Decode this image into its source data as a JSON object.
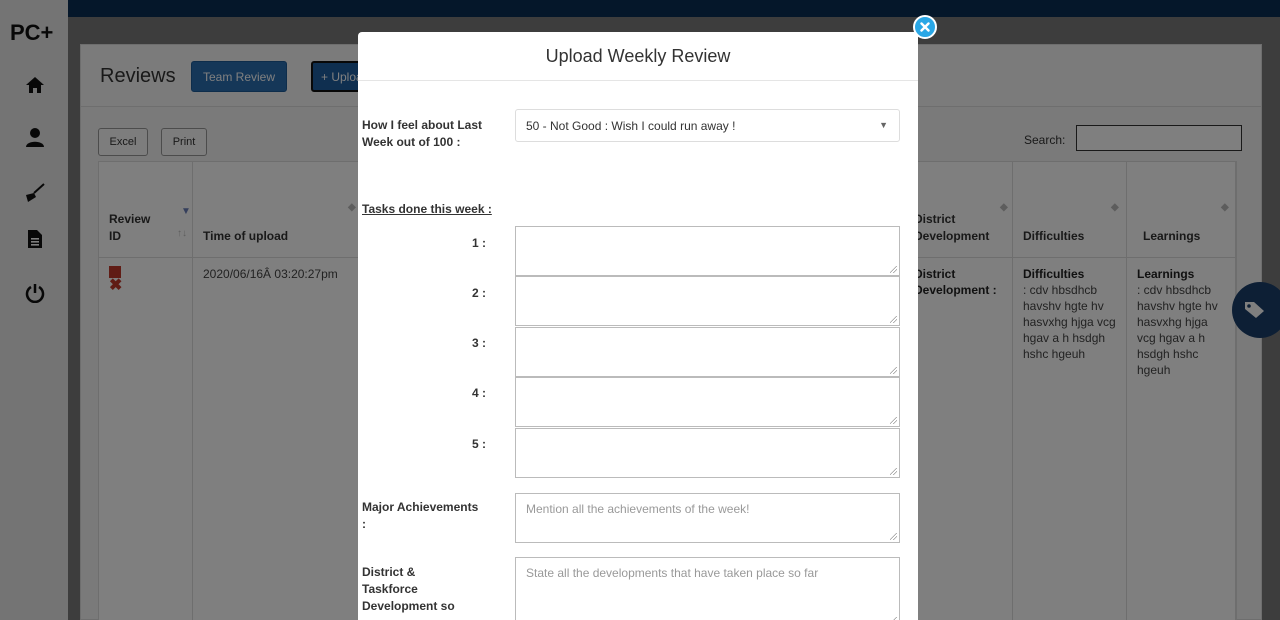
{
  "brand": "PC+",
  "sidebar": {
    "icons": [
      "home-icon",
      "user-icon",
      "broom-icon",
      "document-icon",
      "power-icon"
    ]
  },
  "page": {
    "title": "Reviews",
    "team_review_label": "Team Review",
    "upload_label": "+ Upload",
    "excel_label": "Excel",
    "print_label": "Print",
    "search_label": "Search:"
  },
  "table": {
    "headers": {
      "review_id": "Review ID",
      "time": "Time of upload",
      "district": "District Development",
      "difficulties": "Difficulties",
      "learnings": "Learnings"
    },
    "row": {
      "time": "2020/06/16Â 03:20:27pm",
      "district": "District Development :",
      "difficulties_title": "Difficulties",
      "difficulties_text": ": cdv hbsdhcb havshv hgte hv hasvxhg hjga vcg hgav a h hsdgh hshc hgeuh",
      "learnings_title": "Learnings",
      "learnings_text": ": cdv hbsdhcb havshv hgte hv hasvxhg hjga vcg hgav a h hsdgh hshc hgeuh"
    }
  },
  "modal": {
    "title": "Upload Weekly Review",
    "feel_label": "How I feel about Last Week out of 100 :",
    "feel_value": "50 - Not Good : Wish I could run away !",
    "tasks_heading": "Tasks done this week :",
    "task_numbers": [
      "1 :",
      "2 :",
      "3 :",
      "4 :",
      "5 :"
    ],
    "achievements_label": "Major Achievements :",
    "achievements_placeholder": "Mention all the achievements of the week!",
    "district_label": "District & Taskforce Development so",
    "district_placeholder": "State all the developments that have taken place so far"
  },
  "colors": {
    "topbar": "#0b2e55",
    "primary_button": "#2a6fb1",
    "close_button": "#2aa7e6",
    "delete_icon": "#c0392b"
  }
}
